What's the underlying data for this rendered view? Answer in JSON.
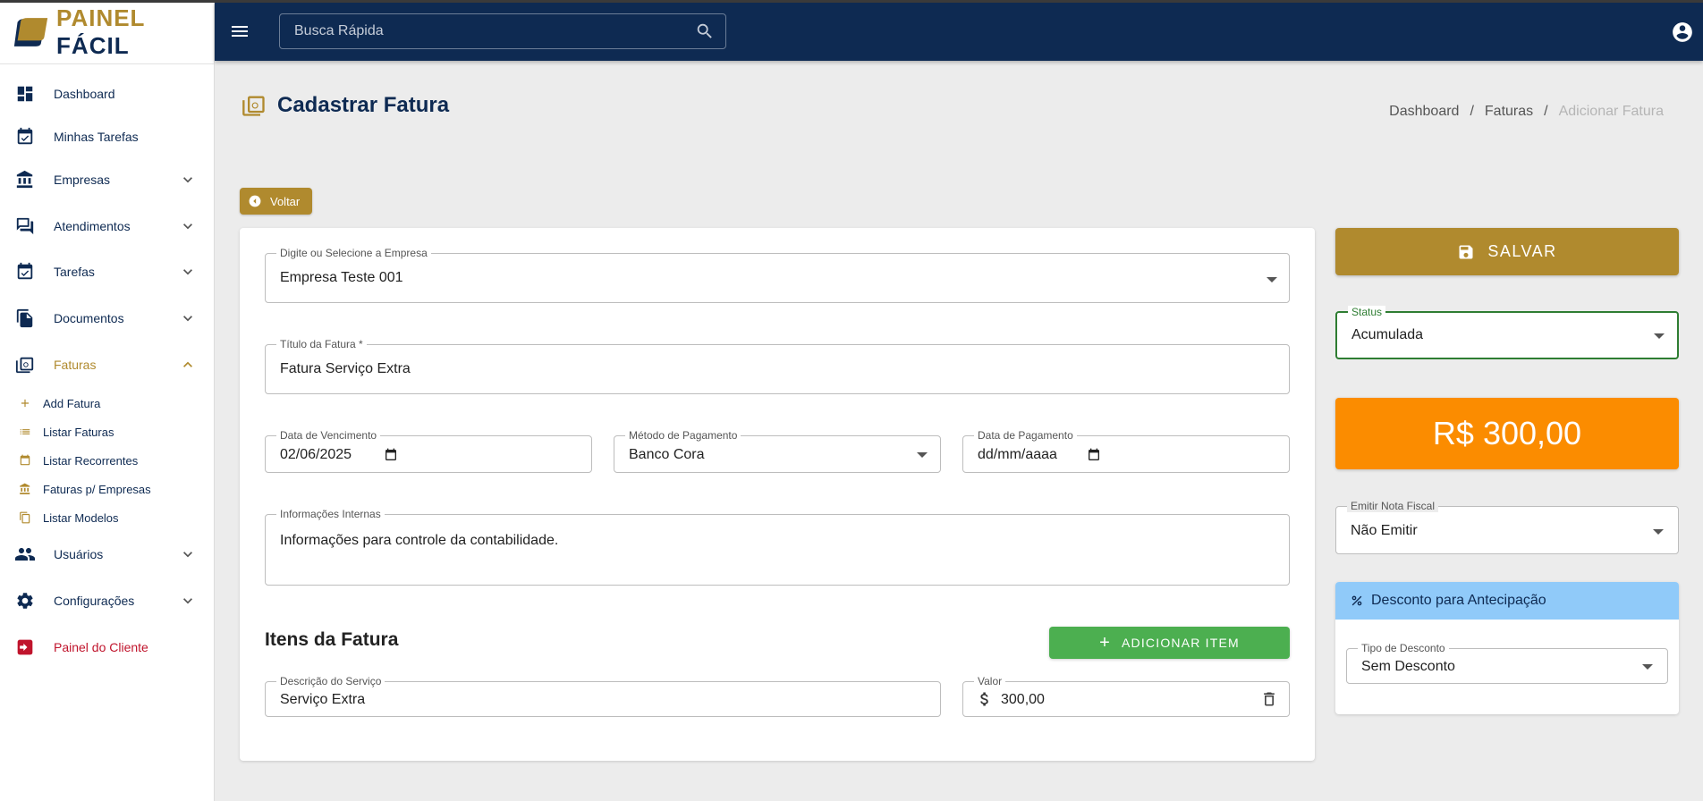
{
  "app": {
    "logo_part1": "PAINEL",
    "logo_part2": "FÁCIL"
  },
  "sidebar": {
    "items": [
      {
        "label": "Dashboard"
      },
      {
        "label": "Minhas Tarefas"
      },
      {
        "label": "Empresas"
      },
      {
        "label": "Atendimentos"
      },
      {
        "label": "Tarefas"
      },
      {
        "label": "Documentos"
      },
      {
        "label": "Faturas"
      },
      {
        "label": "Usuários"
      },
      {
        "label": "Configurações"
      },
      {
        "label": "Painel do Cliente"
      }
    ],
    "faturas_sub": [
      {
        "label": "Add Fatura"
      },
      {
        "label": "Listar Faturas"
      },
      {
        "label": "Listar Recorrentes"
      },
      {
        "label": "Faturas p/ Empresas"
      },
      {
        "label": "Listar Modelos"
      }
    ]
  },
  "topbar": {
    "search_placeholder": "Busca Rápida"
  },
  "page": {
    "title": "Cadastrar Fatura",
    "breadcrumb": [
      "Dashboard",
      "Faturas",
      "Adicionar Fatura"
    ],
    "breadcrumb_sep": "/",
    "back_label": "Voltar"
  },
  "form": {
    "empresa_label": "Digite ou Selecione a Empresa",
    "empresa_value": "Empresa Teste 001",
    "titulo_label": "Título da Fatura *",
    "titulo_value": "Fatura Serviço Extra",
    "vencimento_label": "Data de Vencimento",
    "vencimento_value": "02/06/2025",
    "metodo_label": "Método de Pagamento",
    "metodo_value": "Banco Cora",
    "pagamento_label": "Data de Pagamento",
    "pagamento_value": "dd/mm/aaaa",
    "info_label": "Informações Internas",
    "info_value": "Informações para controle da contabilidade."
  },
  "items_section": {
    "title": "Itens da Fatura",
    "add_label": "ADICIONAR ITEM",
    "rows": [
      {
        "desc_label": "Descrição do Serviço",
        "desc_value": "Serviço Extra",
        "valor_label": "Valor",
        "valor_value": "300,00"
      }
    ]
  },
  "side": {
    "save_label": "SALVAR",
    "status_label": "Status",
    "status_value": "Acumulada",
    "total": "R$ 300,00",
    "nota_label": "Emitir Nota Fiscal",
    "nota_value": "Não Emitir",
    "discount_title": "Desconto para Antecipação",
    "discount_type_label": "Tipo de Desconto",
    "discount_type_value": "Sem Desconto"
  },
  "colors": {
    "brand_gold": "#b08a2e",
    "brand_navy": "#0e2a52",
    "success": "#4caf50",
    "total_orange": "#fb8c00",
    "discount_header": "#90caf9",
    "status_focus": "#2e7d32"
  }
}
